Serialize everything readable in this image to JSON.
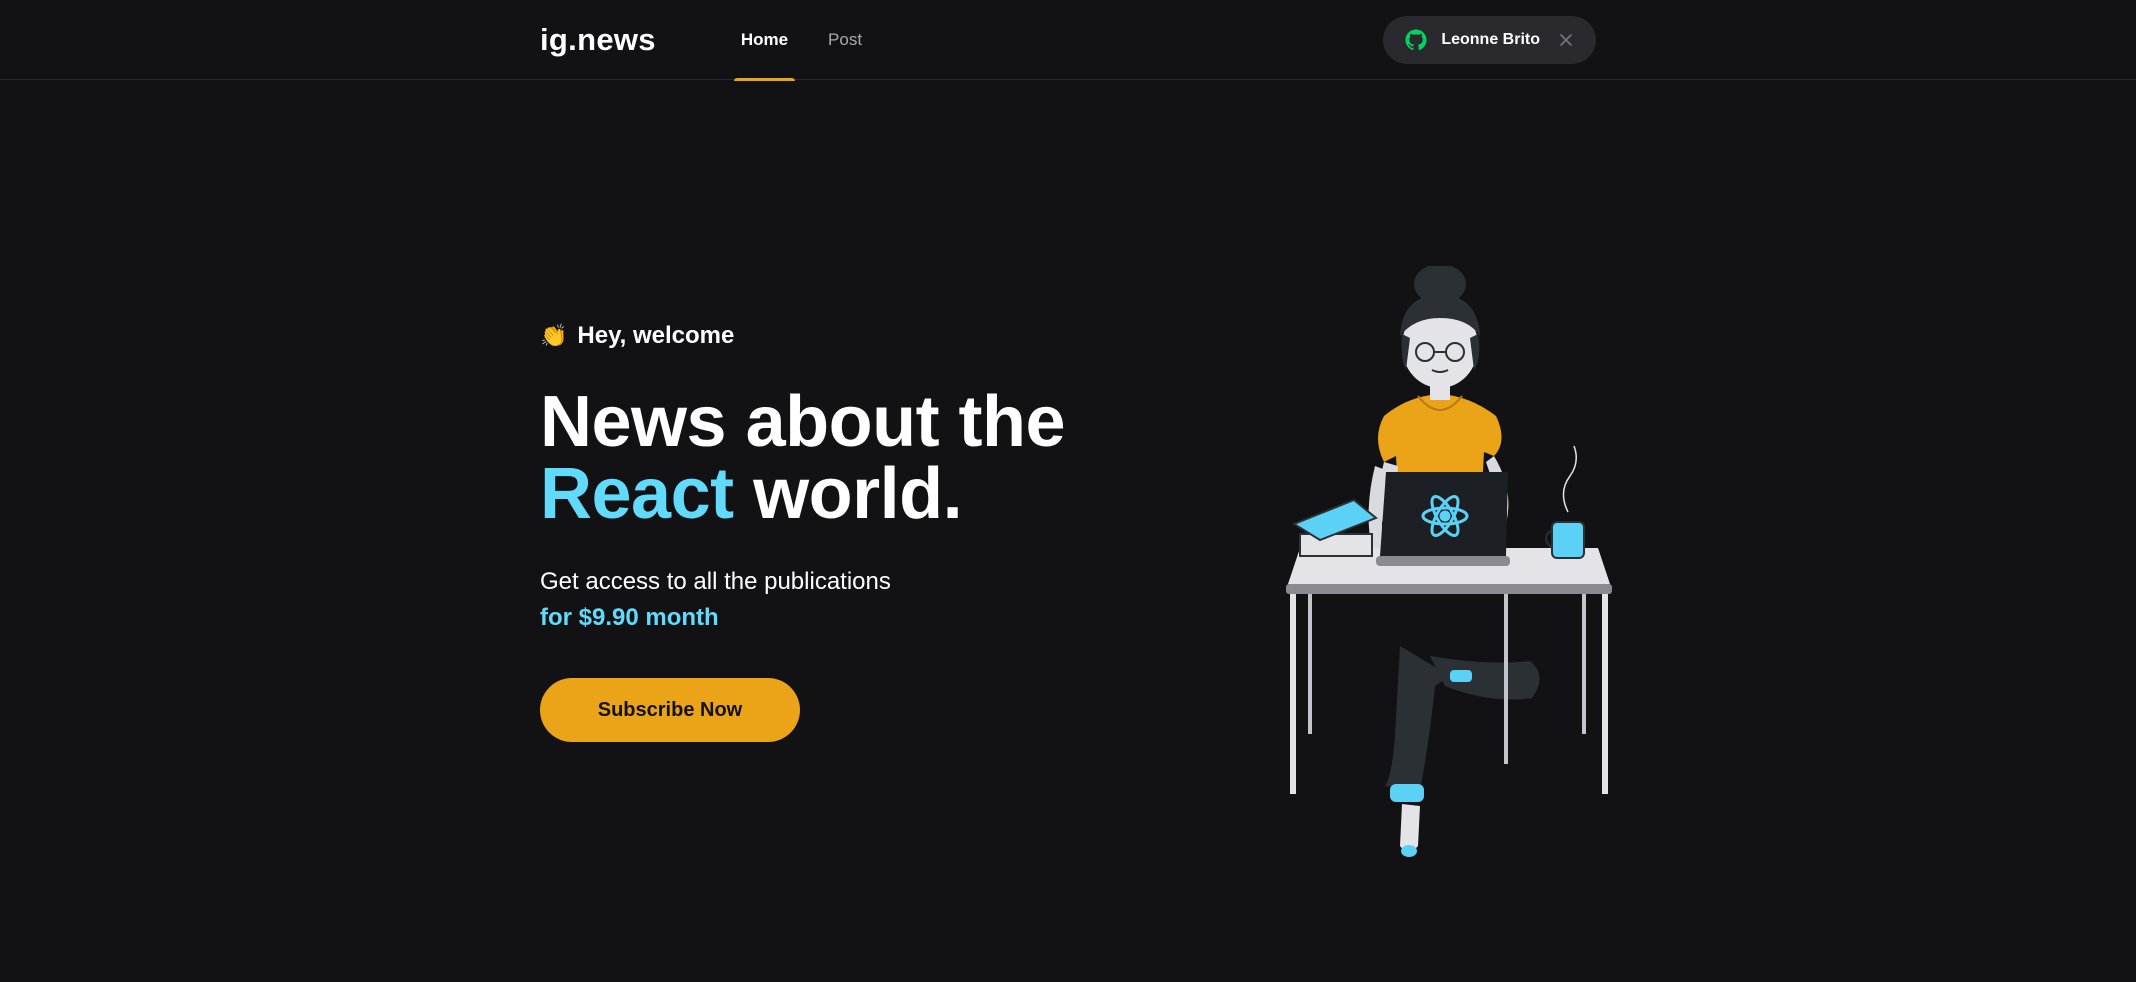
{
  "header": {
    "logo_main": "ig",
    "logo_dot": ".",
    "logo_suffix": "news",
    "nav": [
      {
        "label": "Home",
        "active": true
      },
      {
        "label": "Post",
        "active": false
      }
    ],
    "signin": {
      "user_name": "Leonne Brito",
      "icon": "github-icon",
      "close_icon": "close-icon"
    }
  },
  "hero": {
    "welcome_icon": "👏",
    "welcome_text": "Hey, welcome",
    "headline_line1": "News about the",
    "headline_accent": "React",
    "headline_rest": " world.",
    "subtitle": "Get access to all the publications",
    "price": "for $9.90 month",
    "subscribe_label": "Subscribe Now"
  },
  "colors": {
    "background": "#121214",
    "accent_yellow": "#eba417",
    "accent_cyan": "#61dafb",
    "github_green": "#04d361",
    "gray_box": "#29292e"
  }
}
